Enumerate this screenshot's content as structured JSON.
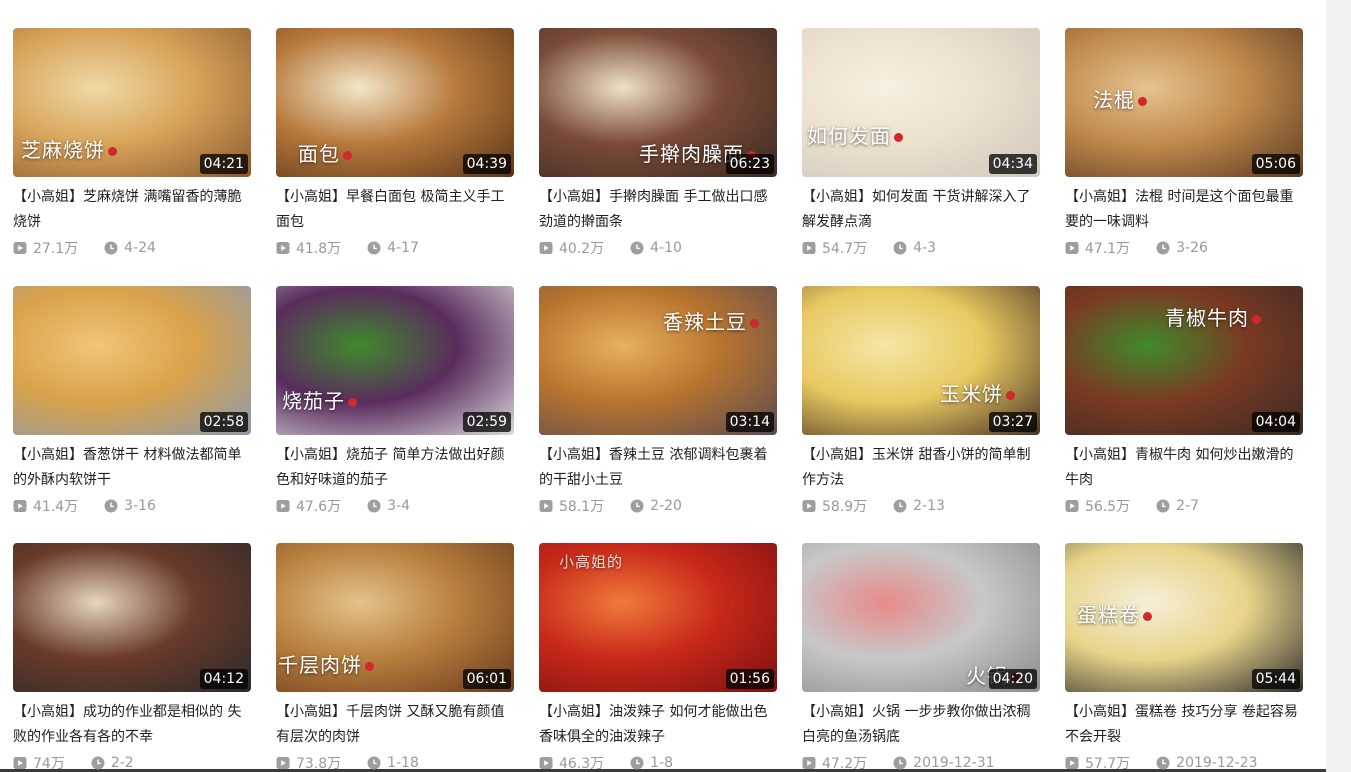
{
  "videos": [
    {
      "overlay": "芝麻烧饼",
      "duration": "04:21",
      "title": "【小高姐】芝麻烧饼 满嘴留香的薄脆烧饼",
      "plays": "27.1万",
      "date": "4-24",
      "palette": [
        "#8a5a2e",
        "#d8a45a",
        "#f0d9a6"
      ]
    },
    {
      "overlay": "面包",
      "duration": "04:39",
      "title": "【小高姐】早餐白面包 极简主义手工面包",
      "plays": "41.8万",
      "date": "4-17",
      "palette": [
        "#5a3417",
        "#b7793c",
        "#f3e6c9"
      ]
    },
    {
      "overlay": "手擀肉臊面",
      "duration": "06:23",
      "title": "【小高姐】手擀肉臊面 手工做出口感劲道的擀面条",
      "plays": "40.2万",
      "date": "4-10",
      "palette": [
        "#3a2a22",
        "#7a4a36",
        "#efe2c4"
      ]
    },
    {
      "overlay": "如何发面",
      "duration": "04:34",
      "title": "【小高姐】如何发面 干货讲解深入了解发酵点滴",
      "plays": "54.7万",
      "date": "4-3",
      "palette": [
        "#cfc7bc",
        "#ece1cf",
        "#f7efe0"
      ]
    },
    {
      "overlay": "法棍",
      "duration": "05:06",
      "title": "【小高姐】法棍 时间是这个面包最重要的一味调料",
      "plays": "47.1万",
      "date": "3-26",
      "palette": [
        "#5b3a22",
        "#c08a4c",
        "#e6c390"
      ]
    },
    {
      "overlay": "",
      "duration": "02:58",
      "title": "【小高姐】香葱饼干 材料做法都简单的外酥内软饼干",
      "plays": "41.4万",
      "date": "3-16",
      "palette": [
        "#8c99ad",
        "#d9a24a",
        "#f0c57a"
      ]
    },
    {
      "overlay": "烧茄子",
      "duration": "02:59",
      "title": "【小高姐】烧茄子 简单方法做出好颜色和好味道的茄子",
      "plays": "47.6万",
      "date": "3-4",
      "palette": [
        "#dcdcdc",
        "#5a2c5e",
        "#3f8a2c"
      ]
    },
    {
      "overlay": "香辣土豆",
      "duration": "03:14",
      "title": "【小高姐】香辣土豆 浓郁调料包裹着的干甜小土豆",
      "plays": "58.1万",
      "date": "2-20",
      "palette": [
        "#5a4a52",
        "#b8742e",
        "#e8b060"
      ]
    },
    {
      "overlay": "玉米饼",
      "duration": "03:27",
      "title": "【小高姐】玉米饼 甜香小饼的简单制作方法",
      "plays": "58.9万",
      "date": "2-13",
      "palette": [
        "#4a3226",
        "#e8c860",
        "#f5e6a6"
      ]
    },
    {
      "overlay": "青椒牛肉",
      "duration": "04:04",
      "title": "【小高姐】青椒牛肉 如何炒出嫩滑的牛肉",
      "plays": "56.5万",
      "date": "2-7",
      "palette": [
        "#3a2a24",
        "#7a3a22",
        "#3f8a2c"
      ]
    },
    {
      "overlay": "",
      "duration": "04:12",
      "title": "【小高姐】成功的作业都是相似的 失败的作业各有各的不幸",
      "plays": "74万",
      "date": "2-2",
      "palette": [
        "#2a2a2a",
        "#6a3a2a",
        "#e6d6c0"
      ]
    },
    {
      "overlay": "千层肉饼",
      "duration": "06:01",
      "title": "【小高姐】千层肉饼 又酥又脆有颜值有层次的肉饼",
      "plays": "73.8万",
      "date": "1-18",
      "palette": [
        "#6a3a1e",
        "#b8803e",
        "#e4c28a"
      ]
    },
    {
      "overlay": "",
      "duration": "01:56",
      "title": "【小高姐】油泼辣子 如何才能做出色香味俱全的油泼辣子",
      "plays": "46.3万",
      "date": "1-8",
      "palette": [
        "#7a1010",
        "#c8281a",
        "#f07a3a"
      ]
    },
    {
      "overlay": "火锅",
      "duration": "04:20",
      "title": "【小高姐】火锅 一步步教你做出浓稠白亮的鱼汤锅底",
      "plays": "47.2万",
      "date": "2019-12-31",
      "palette": [
        "#8a8a8a",
        "#c8c8c8",
        "#e88a8a"
      ]
    },
    {
      "overlay": "蛋糕卷",
      "duration": "05:44",
      "title": "【小高姐】蛋糕卷 技巧分享 卷起容易 不会开裂",
      "plays": "57.7万",
      "date": "2019-12-23",
      "palette": [
        "#2a2a2a",
        "#e8d48a",
        "#f5efd8"
      ]
    }
  ],
  "overlay_watermark": "小高姐的",
  "icons": {
    "play": "play-count-icon",
    "clock": "clock-icon"
  }
}
